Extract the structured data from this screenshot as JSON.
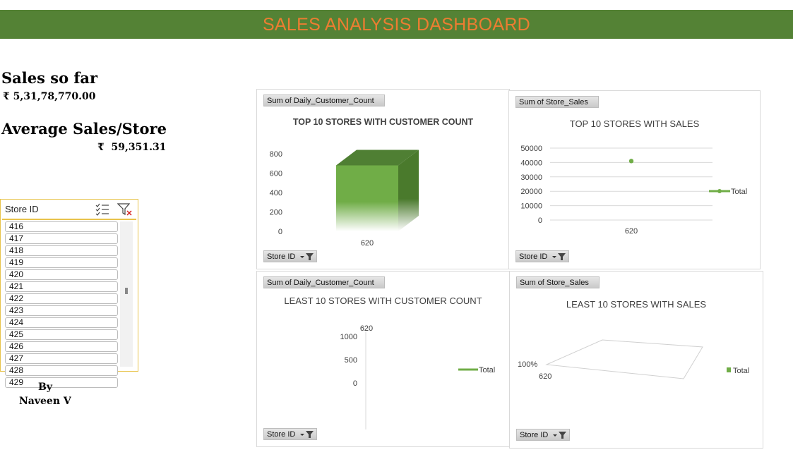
{
  "header": {
    "title": "SALES ANALYSIS DASHBOARD"
  },
  "kpis": {
    "sales_label": "Sales so far",
    "sales_value": "₹ 5,31,78,770.00",
    "avg_label": "Average Sales/Store",
    "avg_value": "₹  59,351.31"
  },
  "slicer": {
    "title": "Store ID",
    "items": [
      "416",
      "417",
      "418",
      "419",
      "420",
      "421",
      "422",
      "423",
      "424",
      "425",
      "426",
      "427",
      "428",
      "429"
    ]
  },
  "byline": {
    "line1": "By",
    "line2": "Naveen V"
  },
  "colors": {
    "banner": "#548235",
    "title": "#ED7D31",
    "accent": "#70AD47"
  },
  "charts": {
    "c1": {
      "field": "Sum of Daily_Customer_Count",
      "filter": "Store ID"
    },
    "c2": {
      "field": "Sum of Store_Sales",
      "filter": "Store ID"
    },
    "c3": {
      "field": "Sum of Daily_Customer_Count",
      "filter": "Store ID"
    },
    "c4": {
      "field": "Sum of Store_Sales",
      "filter": "Store ID"
    }
  },
  "chart_data": [
    {
      "type": "bar",
      "title": "TOP 10 STORES WITH CUSTOMER COUNT",
      "categories": [
        "620"
      ],
      "values": [
        680
      ],
      "ylim": [
        0,
        800
      ],
      "yticks": [
        "0",
        "200",
        "400",
        "600",
        "800"
      ]
    },
    {
      "type": "line",
      "title": "TOP 10  STORES WITH SALES",
      "categories": [
        "620"
      ],
      "series": [
        {
          "name": "Total",
          "values": [
            41000
          ]
        }
      ],
      "ylim": [
        0,
        50000
      ],
      "yticks": [
        "0",
        "10000",
        "20000",
        "30000",
        "40000",
        "50000"
      ],
      "legend": "right"
    },
    {
      "type": "bar",
      "title": "LEAST 10 STORES WITH CUSTOMER COUNT",
      "categories": [
        "620"
      ],
      "series": [
        {
          "name": "Total",
          "values": [
            0
          ]
        }
      ],
      "ylim": [
        0,
        1000
      ],
      "yticks": [
        "0",
        "500",
        "1000"
      ],
      "legend": "right"
    },
    {
      "type": "area",
      "title": "LEAST 10 STORES WITH SALES",
      "categories": [
        "620"
      ],
      "series": [
        {
          "name": "Total",
          "values": [
            100
          ]
        }
      ],
      "ytick": "100%",
      "legend": "right"
    }
  ]
}
